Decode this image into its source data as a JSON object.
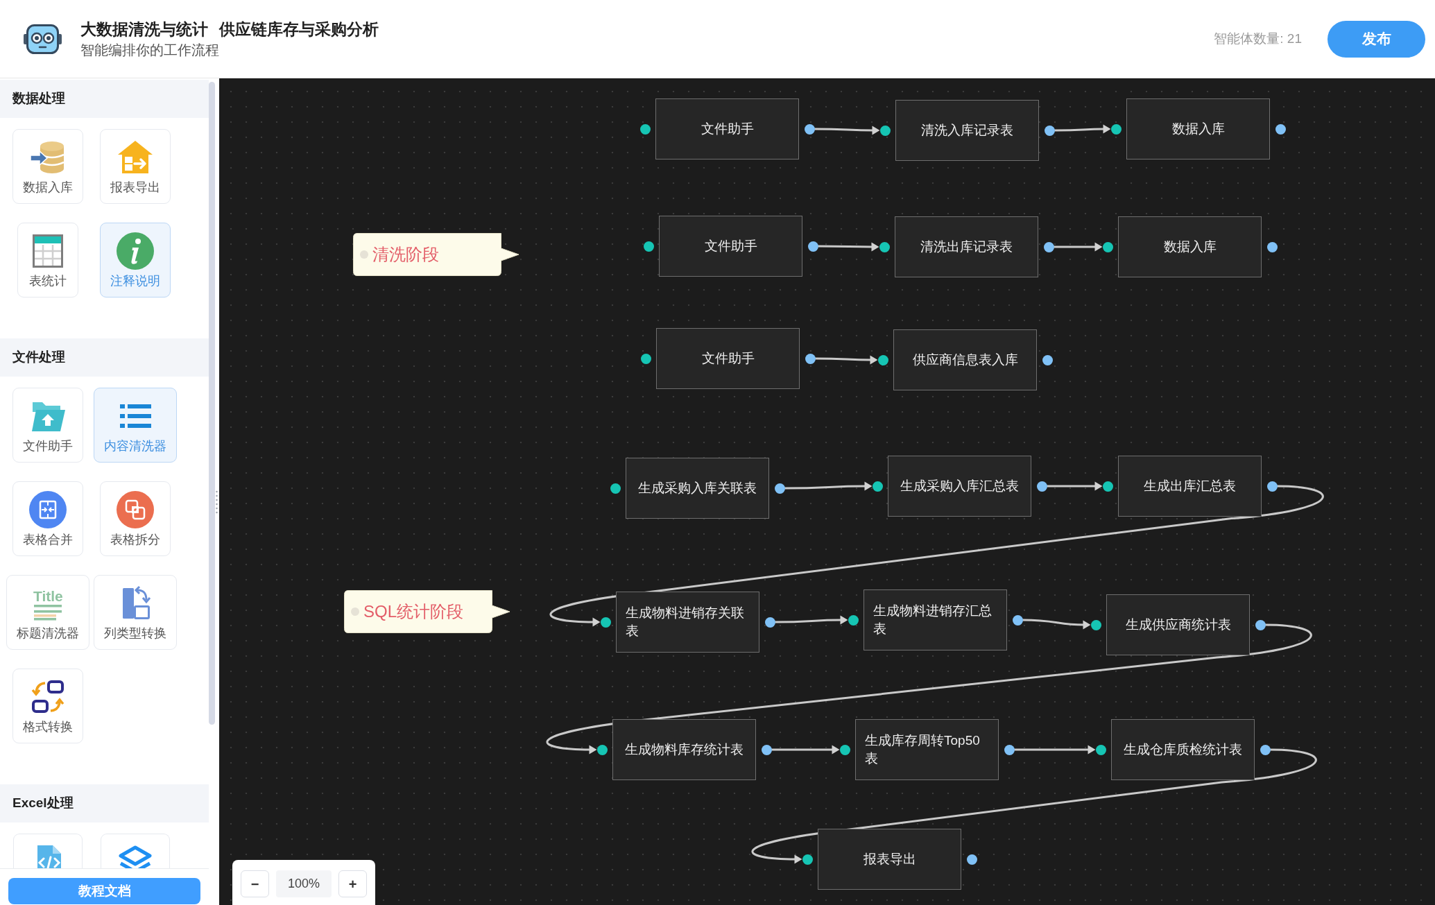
{
  "header": {
    "title": "大数据清洗与统计",
    "project_name": "供应链库存与采购分析",
    "subtitle": "智能编排你的工作流程",
    "agent_count": "智能体数量: 21",
    "publish_button": "发布"
  },
  "sidebar": {
    "sections": [
      {
        "title": "数据处理",
        "items": [
          {
            "label": "数据入库",
            "selected": false
          },
          {
            "label": "报表导出",
            "selected": false
          },
          {
            "label": "表统计",
            "selected": false
          },
          {
            "label": "注释说明",
            "selected": true
          }
        ]
      },
      {
        "title": "文件处理",
        "items": [
          {
            "label": "文件助手",
            "selected": false
          },
          {
            "label": "内容清洗器",
            "selected": true
          },
          {
            "label": "表格合并",
            "selected": false
          },
          {
            "label": "表格拆分",
            "selected": false
          },
          {
            "label": "标题清洗器",
            "icon_text": "Title",
            "selected": false
          },
          {
            "label": "列类型转换",
            "selected": false
          },
          {
            "label": "格式转换",
            "selected": false
          }
        ]
      },
      {
        "title": "Excel处理",
        "items": [
          {
            "selected": false
          },
          {
            "selected": false
          }
        ]
      }
    ],
    "docs_button": "教程文档"
  },
  "canvas": {
    "annotations": [
      {
        "text": "清洗阶段"
      },
      {
        "text": "SQL统计阶段"
      }
    ],
    "pipelines": [
      {
        "nodes": [
          "文件助手",
          "清洗入库记录表",
          "数据入库"
        ]
      },
      {
        "nodes": [
          "文件助手",
          "清洗出库记录表",
          "数据入库"
        ]
      },
      {
        "nodes": [
          "文件助手",
          "供应商信息表入库"
        ]
      },
      {
        "nodes": [
          "生成采购入库关联表",
          "生成采购入库汇总表",
          "生成出库汇总表",
          "生成物料进销存关联表",
          "生成物料进销存汇总表",
          "生成供应商统计表",
          "生成物料库存统计表",
          "生成库存周转Top50表",
          "生成仓库质检统计表",
          "报表导出"
        ]
      }
    ],
    "zoom_controls": {
      "zoom_out": "−",
      "zoom_value": "100%",
      "zoom_in": "+"
    }
  }
}
